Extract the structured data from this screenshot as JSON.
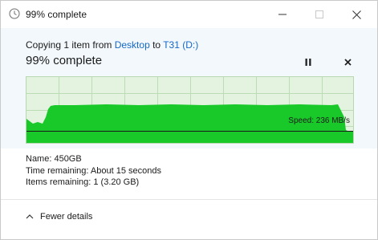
{
  "window": {
    "title": "99% complete",
    "icon": "clock-icon"
  },
  "header": {
    "copy_prefix": "Copying 1 item from ",
    "source": "Desktop",
    "to_word": " to ",
    "destination": "T31 (D:)",
    "percent": "99% complete",
    "progress_fraction": 0.99
  },
  "graph": {
    "speed_label": "Speed: 236 MB/s",
    "fill_color": "#19c92a",
    "bg_color": "#e3f3df"
  },
  "details": {
    "name": "Name: 450GB",
    "time_remaining": "Time remaining:  About 15 seconds",
    "items_remaining": "Items remaining:  1 (3.20 GB)"
  },
  "footer": {
    "fewer_details": "Fewer details"
  }
}
